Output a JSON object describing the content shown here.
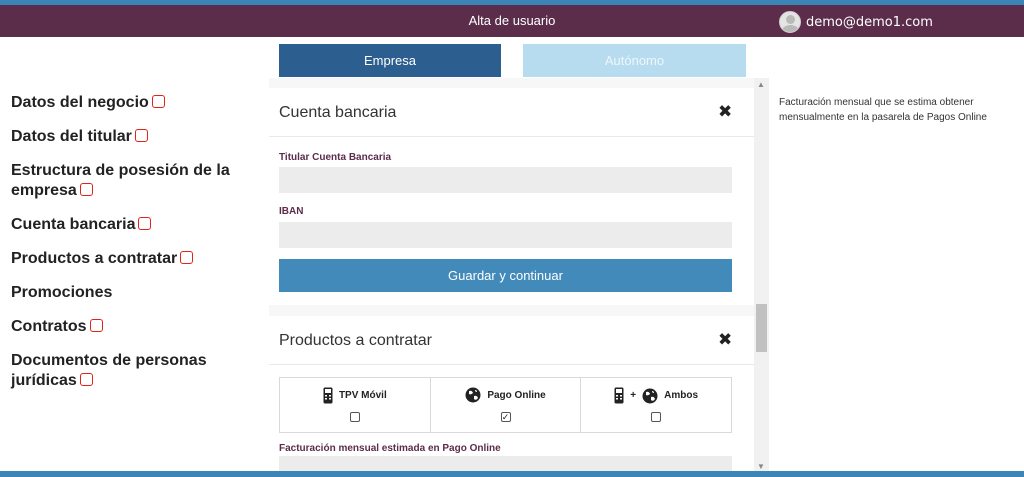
{
  "header": {
    "title": "Alta de usuario",
    "user_email": "demo@demo1.com"
  },
  "sidebar": {
    "items": [
      {
        "label": "Datos del negocio",
        "mark": true
      },
      {
        "label": "Datos del titular",
        "mark": true
      },
      {
        "label": "Estructura de posesión de la empresa",
        "mark": true
      },
      {
        "label": "Cuenta bancaria",
        "mark": true
      },
      {
        "label": "Productos a contratar",
        "mark": true
      },
      {
        "label": "Promociones",
        "mark": false
      },
      {
        "label": "Contratos",
        "mark": true
      },
      {
        "label": "Documentos de personas jurídicas",
        "mark": true
      }
    ]
  },
  "tabs": {
    "empresa": "Empresa",
    "autonomo": "Autónomo"
  },
  "bank_section": {
    "title": "Cuenta bancaria",
    "holder_label": "Titular Cuenta Bancaria",
    "holder_value": "",
    "iban_label": "IBAN",
    "iban_value": "",
    "submit_label": "Guardar y continuar"
  },
  "products_section": {
    "title": "Productos a contratar",
    "tpv_label": "TPV Móvil",
    "online_label": "Pago Online",
    "both_label": "Ambos",
    "plus": "+",
    "online_check": "✓",
    "billing_label": "Facturación mensual estimada en Pago Online"
  },
  "help": {
    "text": "Facturación mensual que se estima obtener mensualmente en la pasarela de Pagos Online"
  },
  "icons": {
    "close": "close-icon",
    "phone": "mobile-pos-icon",
    "globe": "globe-icon"
  }
}
